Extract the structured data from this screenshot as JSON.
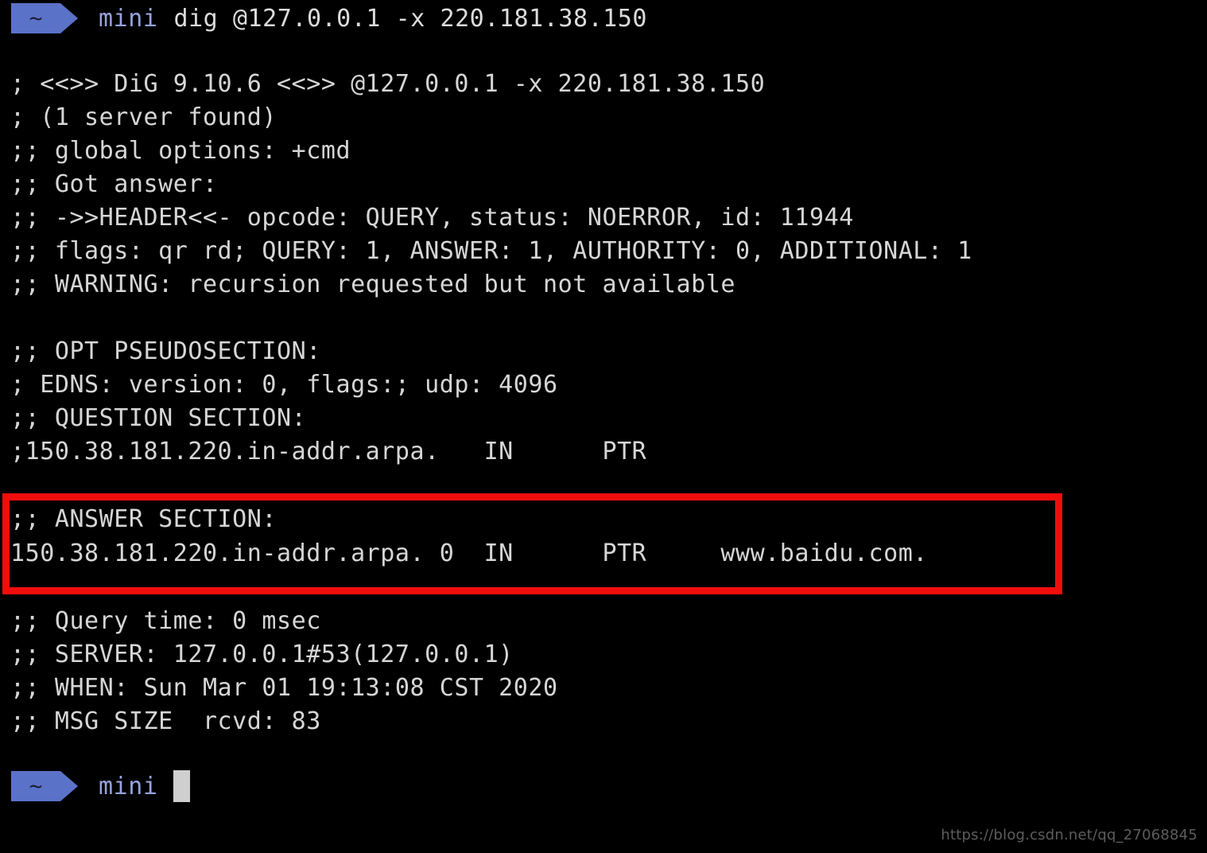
{
  "terminal": {
    "background_color": "#000000",
    "foreground_color": "#d6d6d6",
    "prompt_segment_color": "#5b72c9",
    "prompt_host_color": "#97a3dc",
    "highlight_color": "#f20d0d",
    "cursor_color": "#cfcfcf"
  },
  "command_prompt": {
    "segment_symbol": "~",
    "host": "mini",
    "command": "dig @127.0.0.1 -x 220.181.38.150"
  },
  "output": {
    "lines": [
      "; <<>> DiG 9.10.6 <<>> @127.0.0.1 -x 220.181.38.150",
      "; (1 server found)",
      ";; global options: +cmd",
      ";; Got answer:",
      ";; ->>HEADER<<- opcode: QUERY, status: NOERROR, id: 11944",
      ";; flags: qr rd; QUERY: 1, ANSWER: 1, AUTHORITY: 0, ADDITIONAL: 1",
      ";; WARNING: recursion requested but not available",
      "",
      ";; OPT PSEUDOSECTION:",
      "; EDNS: version: 0, flags:; udp: 4096",
      ";; QUESTION SECTION:",
      ";150.38.181.220.in-addr.arpa.   IN      PTR",
      "",
      ";; ANSWER SECTION:",
      "150.38.181.220.in-addr.arpa. 0  IN      PTR     www.baidu.com.",
      "",
      ";; Query time: 0 msec",
      ";; SERVER: 127.0.0.1#53(127.0.0.1)",
      ";; WHEN: Sun Mar 01 19:13:08 CST 2020",
      ";; MSG SIZE  rcvd: 83"
    ]
  },
  "answer_section": {
    "header": ";; ANSWER SECTION:",
    "record": "150.38.181.220.in-addr.arpa. 0  IN      PTR     www.baidu.com.",
    "record_name": "150.38.181.220.in-addr.arpa.",
    "record_ttl": "0",
    "record_class": "IN",
    "record_type": "PTR",
    "record_value": "www.baidu.com."
  },
  "final_prompt": {
    "segment_symbol": "~",
    "host": "mini",
    "command": ""
  },
  "watermark": {
    "text": "https://blog.csdn.net/qq_27068845"
  }
}
